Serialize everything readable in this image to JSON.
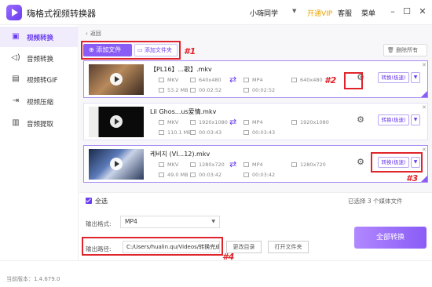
{
  "app": {
    "title": "嗨格式视频转换器",
    "user": "小嗨同学",
    "vip": "开通VIP",
    "service": "客服",
    "menu": "菜单"
  },
  "sidebar": {
    "items": [
      {
        "label": "视频转换",
        "active": true,
        "icon": "video-convert-icon"
      },
      {
        "label": "音频转换",
        "active": false,
        "icon": "audio-icon"
      },
      {
        "label": "视频转GIF",
        "active": false,
        "icon": "gif-icon"
      },
      {
        "label": "视频压缩",
        "active": false,
        "icon": "compress-icon"
      },
      {
        "label": "音频提取",
        "active": false,
        "icon": "extract-icon"
      }
    ]
  },
  "toolbar": {
    "back": "返回",
    "add_file": "添加文件",
    "add_folder": "添加文件夹",
    "delete_all": "删除所有"
  },
  "annotations": {
    "a1": "#1",
    "a2": "#2",
    "a3": "#3",
    "a4": "#4"
  },
  "files": [
    {
      "name": "【PL16】...歌】.mkv",
      "src_format": "MKV",
      "src_res": "640x480",
      "src_size": "53.2 MB",
      "src_dur": "00:02:52",
      "dst_format": "MP4",
      "dst_res": "640x480",
      "dst_dur": "00:02:52",
      "convert": "转换(极速)"
    },
    {
      "name": "Lil Ghos...us爱情.mkv",
      "src_format": "MKV",
      "src_res": "1920x1080",
      "src_size": "110.1 MB",
      "src_dur": "00:03:43",
      "dst_format": "MP4",
      "dst_res": "1920x1080",
      "dst_dur": "00:03:43",
      "convert": "转换(极速)"
    },
    {
      "name": "케비지 (VI...12).mkv",
      "src_format": "MKV",
      "src_res": "1280x720",
      "src_size": "49.0 MB",
      "src_dur": "00:03:42",
      "dst_format": "MP4",
      "dst_res": "1280x720",
      "dst_dur": "00:03:42",
      "convert": "转换(极速)"
    }
  ],
  "bottom": {
    "select_all": "全选",
    "selected_count": "已选择 3 个媒体文件",
    "format_label": "输出格式:",
    "format_value": "MP4",
    "output_label": "输出路径:",
    "output_path": "C:/Users/hualin.qu/Videos/转换完成",
    "change_dir": "更改目录",
    "open_folder": "打开文件夹",
    "convert_all": "全部转换"
  },
  "status": {
    "version": "当前版本：1.4.679.0"
  },
  "colors": {
    "accent": "#8a5cf6",
    "annotation": "#e0242b"
  }
}
